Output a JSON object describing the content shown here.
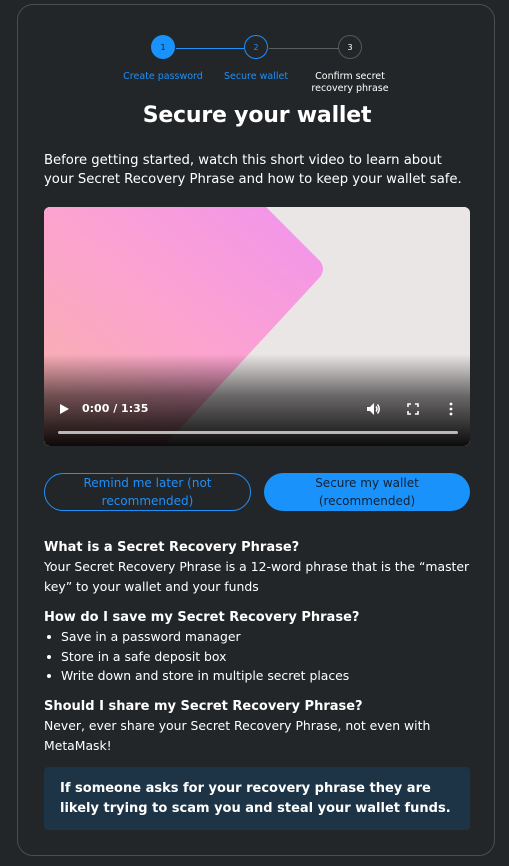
{
  "stepper": {
    "steps": [
      {
        "number": "1",
        "label": "Create password",
        "state": "complete"
      },
      {
        "number": "2",
        "label": "Secure wallet",
        "state": "current"
      },
      {
        "number": "3",
        "label": "Confirm secret recovery phrase",
        "state": "upcoming"
      }
    ]
  },
  "page": {
    "title": "Secure your wallet",
    "intro": "Before getting started, watch this short video to learn about your Secret Recovery Phrase and how to keep your wallet safe."
  },
  "video": {
    "time": "0:00 / 1:35",
    "progress": 0.0
  },
  "buttons": {
    "remind_later": "Remind me later (not recommended)",
    "secure_wallet": "Secure my wallet (recommended)"
  },
  "sections": {
    "what": {
      "heading": "What is a Secret Recovery Phrase?",
      "body": "Your Secret Recovery Phrase is a 12-word phrase that is the “master key” to your wallet and your funds"
    },
    "how": {
      "heading": "How do I save my Secret Recovery Phrase?",
      "items": [
        "Save in a password manager",
        "Store in a safe deposit box",
        "Write down and store in multiple secret places"
      ]
    },
    "share": {
      "heading": "Should I share my Secret Recovery Phrase?",
      "body": "Never, ever share your Secret Recovery Phrase, not even with MetaMask!"
    }
  },
  "warning": {
    "text": "If someone asks for your recovery phrase they are likely trying to scam you and steal your wallet funds."
  },
  "colors": {
    "accent": "#1a92fb",
    "background": "#232628",
    "warning_bg": "#1c3446"
  },
  "icons": {
    "play": "play-icon",
    "volume": "volume-icon",
    "fullscreen": "fullscreen-icon",
    "more": "more-vertical-icon"
  }
}
